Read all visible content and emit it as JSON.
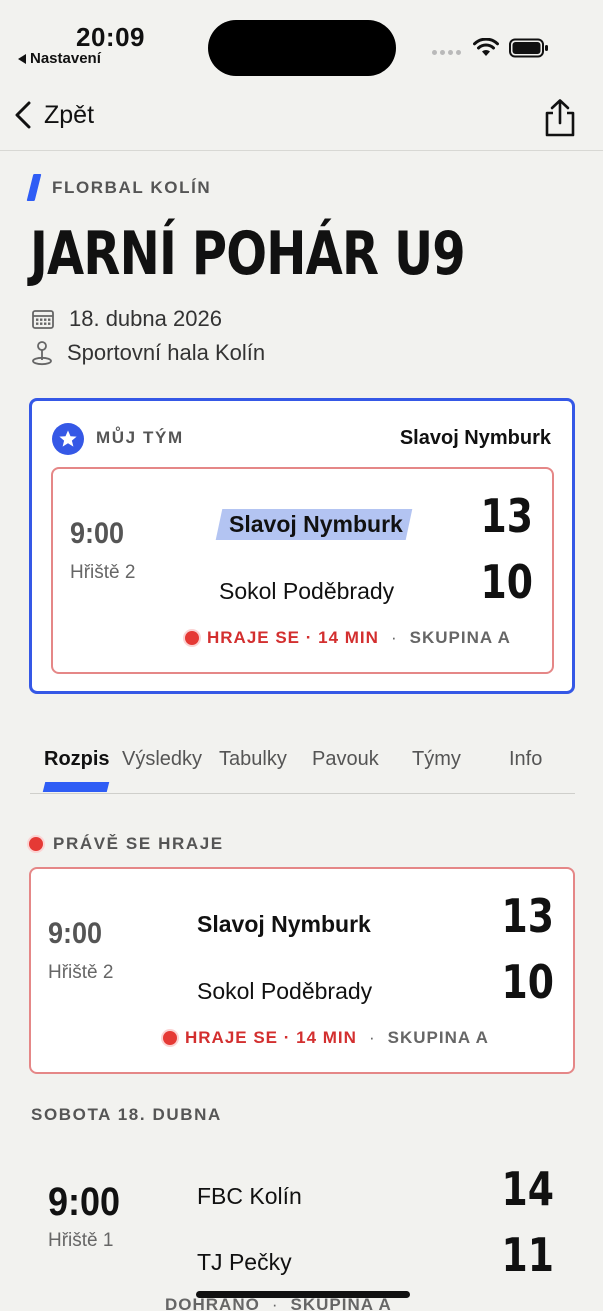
{
  "status_bar": {
    "time": "20:09",
    "back_app": "Nastavení"
  },
  "nav": {
    "back_label": "Zpět"
  },
  "header": {
    "organizer": "FLORBAL KOLÍN",
    "title": "JARNÍ POHÁR U9",
    "date": "18. dubna 2026",
    "venue": "Sportovní hala Kolín"
  },
  "my_team": {
    "label": "MŮJ TÝM",
    "team": "Slavoj Nymburk",
    "match": {
      "time": "9:00",
      "court": "Hřiště 2",
      "home": "Slavoj Nymburk",
      "away": "Sokol Poděbrady",
      "home_score": "13",
      "away_score": "10",
      "status": "HRAJE SE · 14 MIN",
      "separator": "·",
      "group": "SKUPINA A"
    }
  },
  "tabs": [
    {
      "label": "Rozpis"
    },
    {
      "label": "Výsledky"
    },
    {
      "label": "Tabulky"
    },
    {
      "label": "Pavouk"
    },
    {
      "label": "Týmy"
    },
    {
      "label": "Info"
    }
  ],
  "live_section": {
    "label": "PRÁVĚ SE HRAJE",
    "match": {
      "time": "9:00",
      "court": "Hřiště 2",
      "home": "Slavoj Nymburk",
      "away": "Sokol Poděbrady",
      "home_score": "13",
      "away_score": "10",
      "status": "HRAJE SE · 14 MIN",
      "separator": "·",
      "group": "SKUPINA A"
    }
  },
  "day_section": {
    "label": "SOBOTA 18. DUBNA",
    "match": {
      "time": "9:00",
      "court": "Hřiště 1",
      "home": "FBC Kolín",
      "away": "TJ Pečky",
      "home_score": "14",
      "away_score": "11",
      "status": "DOHRÁNO",
      "separator": "·",
      "group": "SKUPINA A"
    }
  },
  "colors": {
    "accent": "#2f5df5",
    "live": "#d32f2f",
    "live_border": "#e58787"
  }
}
